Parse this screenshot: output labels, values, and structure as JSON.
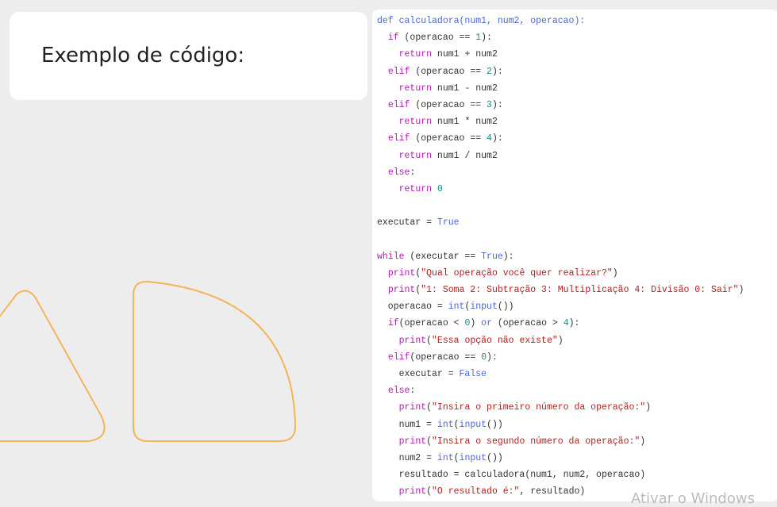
{
  "slide": {
    "title": "Exemplo de código:"
  },
  "code": {
    "lines": [
      [
        {
          "t": "def ",
          "c": "n"
        },
        {
          "t": "calculadora",
          "c": "n"
        },
        {
          "t": "(num1, num2, operacao):",
          "c": "n"
        }
      ],
      [
        {
          "t": "  "
        },
        {
          "t": "if",
          "c": "k"
        },
        {
          "t": " (operacao == "
        },
        {
          "t": "1",
          "c": "m"
        },
        {
          "t": "):"
        }
      ],
      [
        {
          "t": "    "
        },
        {
          "t": "return",
          "c": "k"
        },
        {
          "t": " num1 + num2"
        }
      ],
      [
        {
          "t": "  "
        },
        {
          "t": "elif",
          "c": "k"
        },
        {
          "t": " (operacao == "
        },
        {
          "t": "2",
          "c": "m"
        },
        {
          "t": "):"
        }
      ],
      [
        {
          "t": "    "
        },
        {
          "t": "return",
          "c": "k"
        },
        {
          "t": " num1 - num2"
        }
      ],
      [
        {
          "t": "  "
        },
        {
          "t": "elif",
          "c": "k"
        },
        {
          "t": " (operacao == "
        },
        {
          "t": "3",
          "c": "m"
        },
        {
          "t": "):"
        }
      ],
      [
        {
          "t": "    "
        },
        {
          "t": "return",
          "c": "k"
        },
        {
          "t": " num1 * num2"
        }
      ],
      [
        {
          "t": "  "
        },
        {
          "t": "elif",
          "c": "k"
        },
        {
          "t": " (operacao == "
        },
        {
          "t": "4",
          "c": "m"
        },
        {
          "t": "):"
        }
      ],
      [
        {
          "t": "    "
        },
        {
          "t": "return",
          "c": "k"
        },
        {
          "t": " num1 / num2"
        }
      ],
      [
        {
          "t": "  "
        },
        {
          "t": "else",
          "c": "k"
        },
        {
          "t": ":"
        }
      ],
      [
        {
          "t": "    "
        },
        {
          "t": "return",
          "c": "k"
        },
        {
          "t": " "
        },
        {
          "t": "0",
          "c": "m"
        }
      ],
      [],
      [
        {
          "t": "executar = "
        },
        {
          "t": "True",
          "c": "n"
        }
      ],
      [],
      [
        {
          "t": "while",
          "c": "k"
        },
        {
          "t": " (executar == "
        },
        {
          "t": "True",
          "c": "n"
        },
        {
          "t": "):"
        }
      ],
      [
        {
          "t": "  "
        },
        {
          "t": "print",
          "c": "k"
        },
        {
          "t": "("
        },
        {
          "t": "\"Qual operação você quer realizar?\"",
          "c": "s"
        },
        {
          "t": ")"
        }
      ],
      [
        {
          "t": "  "
        },
        {
          "t": "print",
          "c": "k"
        },
        {
          "t": "("
        },
        {
          "t": "\"1: Soma 2: Subtração 3: Multiplicação 4: Divisão 0: Sair\"",
          "c": "s"
        },
        {
          "t": ")"
        }
      ],
      [
        {
          "t": "  operacao = "
        },
        {
          "t": "int",
          "c": "n"
        },
        {
          "t": "("
        },
        {
          "t": "input",
          "c": "n"
        },
        {
          "t": "())"
        }
      ],
      [
        {
          "t": "  "
        },
        {
          "t": "if",
          "c": "k"
        },
        {
          "t": "(operacao < "
        },
        {
          "t": "0",
          "c": "m"
        },
        {
          "t": ") "
        },
        {
          "t": "or",
          "c": "n"
        },
        {
          "t": " (operacao > "
        },
        {
          "t": "4",
          "c": "m"
        },
        {
          "t": "):"
        }
      ],
      [
        {
          "t": "    "
        },
        {
          "t": "print",
          "c": "k"
        },
        {
          "t": "("
        },
        {
          "t": "\"Essa opção não existe\"",
          "c": "s"
        },
        {
          "t": ")"
        }
      ],
      [
        {
          "t": "  "
        },
        {
          "t": "elif",
          "c": "k"
        },
        {
          "t": "(operacao == "
        },
        {
          "t": "0",
          "c": "m"
        },
        {
          "t": "):"
        }
      ],
      [
        {
          "t": "    executar = "
        },
        {
          "t": "False",
          "c": "n"
        }
      ],
      [
        {
          "t": "  "
        },
        {
          "t": "else",
          "c": "k"
        },
        {
          "t": ":"
        }
      ],
      [
        {
          "t": "    "
        },
        {
          "t": "print",
          "c": "k"
        },
        {
          "t": "("
        },
        {
          "t": "\"Insira o primeiro número da operação:\"",
          "c": "s"
        },
        {
          "t": ")"
        }
      ],
      [
        {
          "t": "    num1 = "
        },
        {
          "t": "int",
          "c": "n"
        },
        {
          "t": "("
        },
        {
          "t": "input",
          "c": "n"
        },
        {
          "t": "())"
        }
      ],
      [
        {
          "t": "    "
        },
        {
          "t": "print",
          "c": "k"
        },
        {
          "t": "("
        },
        {
          "t": "\"Insira o segundo número da operação:\"",
          "c": "s"
        },
        {
          "t": ")"
        }
      ],
      [
        {
          "t": "    num2 = "
        },
        {
          "t": "int",
          "c": "n"
        },
        {
          "t": "("
        },
        {
          "t": "input",
          "c": "n"
        },
        {
          "t": "())"
        }
      ],
      [
        {
          "t": "    resultado = calculadora(num1, num2, operacao)"
        }
      ],
      [
        {
          "t": "    "
        },
        {
          "t": "print",
          "c": "k"
        },
        {
          "t": "("
        },
        {
          "t": "\"O resultado é:\"",
          "c": "s"
        },
        {
          "t": ", resultado)"
        }
      ]
    ]
  },
  "watermark": {
    "text": "Ativar o Windows"
  },
  "colors": {
    "decor_outline": "#f5b35a"
  }
}
